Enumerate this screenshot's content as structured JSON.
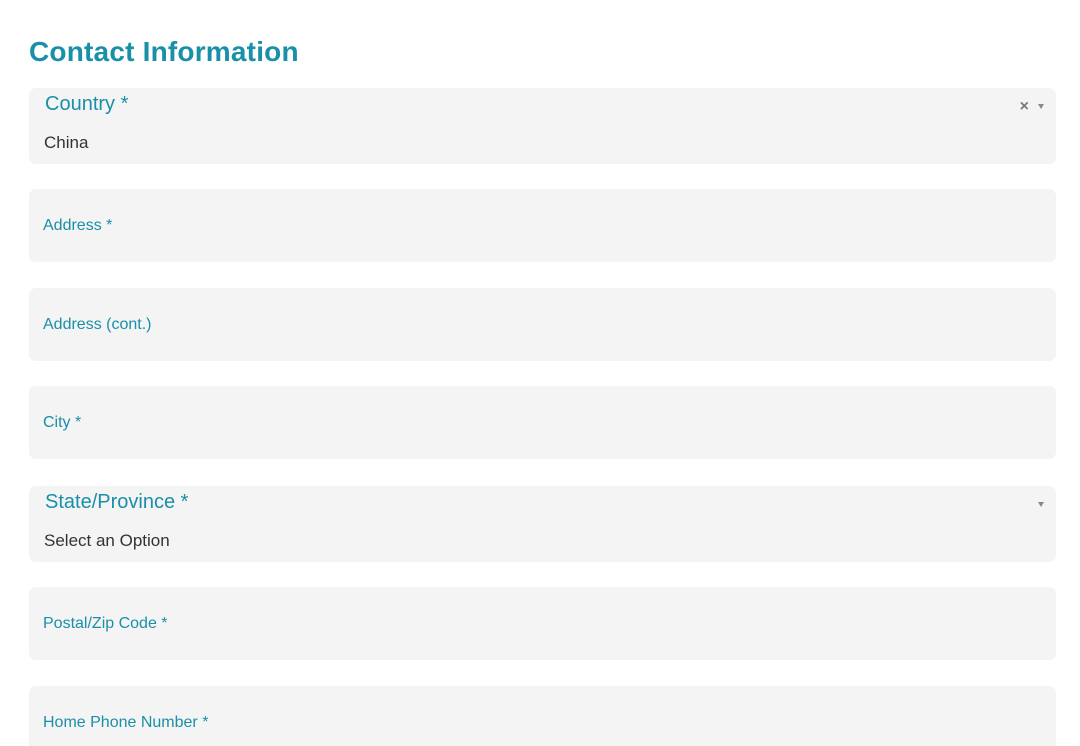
{
  "section": {
    "title": "Contact Information"
  },
  "country": {
    "label": "Country *",
    "value": "China",
    "clear_icon": "close-icon",
    "dropdown_icon": "chevron-down-icon"
  },
  "address": {
    "label": "Address *"
  },
  "address_cont": {
    "label": "Address (cont.)"
  },
  "city": {
    "label": "City *"
  },
  "state": {
    "label": "State/Province *",
    "value": "Select an Option",
    "dropdown_icon": "chevron-down-icon"
  },
  "postal": {
    "label": "Postal/Zip Code *"
  },
  "home_phone": {
    "label": "Home Phone Number *"
  },
  "colors": {
    "accent": "#1a8fa8",
    "field_background": "#f4f4f4",
    "value_text": "#333333"
  }
}
